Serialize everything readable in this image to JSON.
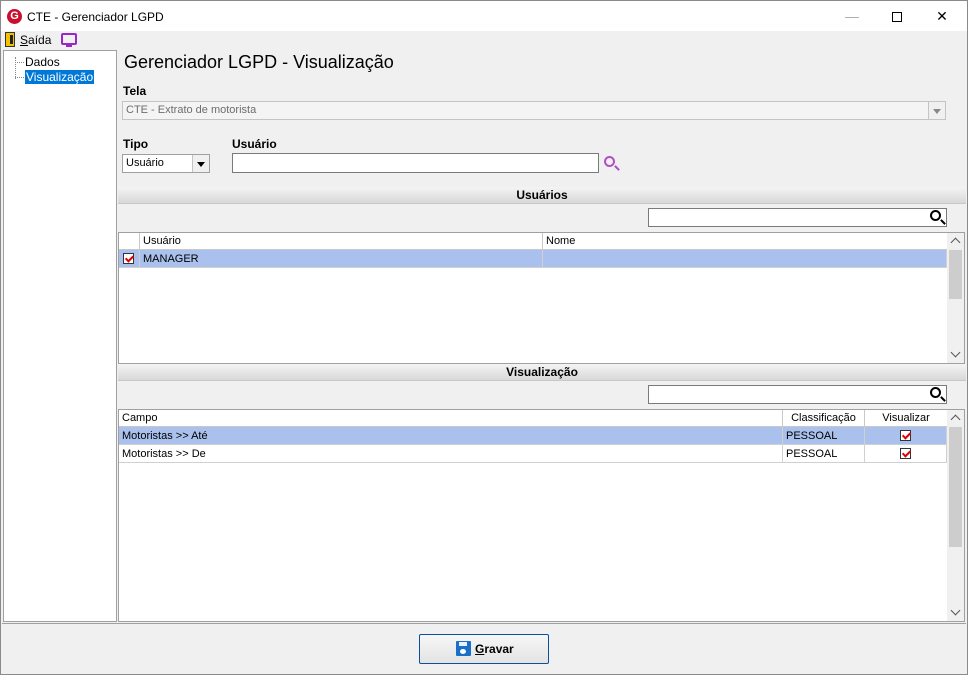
{
  "window": {
    "title": "CTE - Gerenciador LGPD",
    "logo_letter": "G",
    "minimize": "—",
    "close": "✕"
  },
  "menu": {
    "exit_label_first": "S",
    "exit_label_rest": "aída"
  },
  "tree": {
    "items": [
      {
        "label": "Dados",
        "selected": false
      },
      {
        "label": "Visualização",
        "selected": true
      }
    ]
  },
  "main": {
    "title": "Gerenciador LGPD - Visualização",
    "tela_label": "Tela",
    "tela_value": "CTE - Extrato de motorista",
    "tipo_label": "Tipo",
    "tipo_value": "Usuário",
    "usuario_label": "Usuário",
    "usuario_value": ""
  },
  "usuarios_section": {
    "header": "Usuários",
    "search_value": "",
    "columns": [
      "Usuário",
      "Nome"
    ],
    "rows": [
      {
        "checked": true,
        "usuario": "MANAGER",
        "nome": "",
        "selected": true
      }
    ]
  },
  "visualizacao_section": {
    "header": "Visualização",
    "search_value": "",
    "columns": [
      "Campo",
      "Classificação",
      "Visualizar"
    ],
    "rows": [
      {
        "campo": "Motoristas >> Até",
        "classificacao": "PESSOAL",
        "visualizar": true,
        "selected": true
      },
      {
        "campo": "Motoristas >> De",
        "classificacao": "PESSOAL",
        "visualizar": true,
        "selected": false
      }
    ]
  },
  "footer": {
    "save_first": "G",
    "save_rest": "ravar"
  },
  "colors": {
    "selection": "#a9c1ec",
    "tree_selection": "#0078d7",
    "accent_purple": "#9b27c9",
    "check_red": "#d00000"
  }
}
